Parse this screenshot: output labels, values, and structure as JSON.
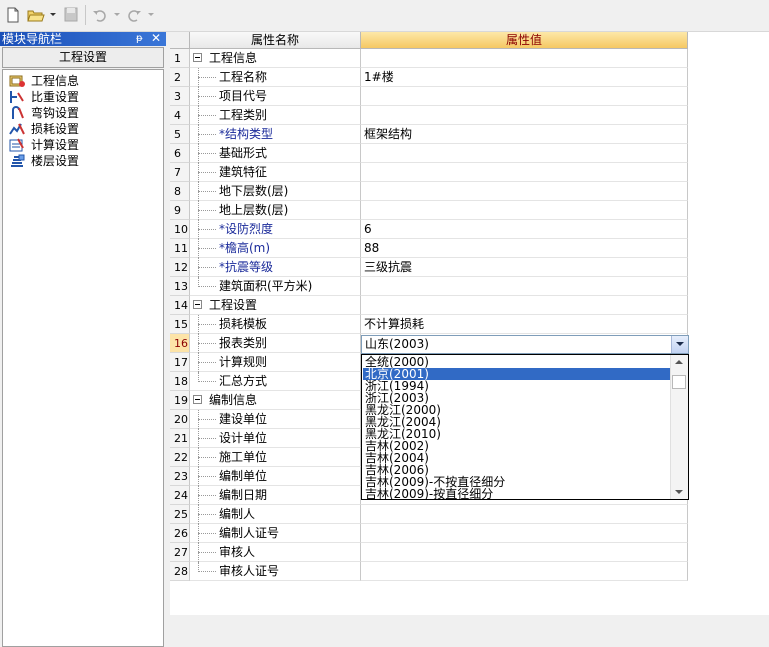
{
  "toolbar": {
    "icons": [
      "new-file-icon",
      "open-folder-icon",
      "save-icon",
      "undo-icon",
      "redo-icon",
      "more-icon"
    ]
  },
  "nav": {
    "title": "模块导航栏",
    "pin": "ᵽ",
    "close": "✕",
    "header": "工程设置",
    "items": [
      {
        "label": "工程信息",
        "icon": "project-info-icon"
      },
      {
        "label": "比重设置",
        "icon": "density-icon"
      },
      {
        "label": "弯钩设置",
        "icon": "hook-icon"
      },
      {
        "label": "损耗设置",
        "icon": "loss-icon"
      },
      {
        "label": "计算设置",
        "icon": "calc-icon"
      },
      {
        "label": "楼层设置",
        "icon": "floor-icon"
      }
    ]
  },
  "grid": {
    "col_name": "属性名称",
    "col_value": "属性值",
    "rows": [
      {
        "num": "1",
        "name": "工程信息",
        "value": "",
        "type": "group"
      },
      {
        "num": "2",
        "name": "工程名称",
        "value": "1#楼",
        "type": "child"
      },
      {
        "num": "3",
        "name": "项目代号",
        "value": "",
        "type": "child"
      },
      {
        "num": "4",
        "name": "工程类别",
        "value": "",
        "type": "child"
      },
      {
        "num": "5",
        "name": "*结构类型",
        "value": "框架结构",
        "type": "child",
        "req": true
      },
      {
        "num": "6",
        "name": "基础形式",
        "value": "",
        "type": "child"
      },
      {
        "num": "7",
        "name": "建筑特征",
        "value": "",
        "type": "child"
      },
      {
        "num": "8",
        "name": "地下层数(层)",
        "value": "",
        "type": "child"
      },
      {
        "num": "9",
        "name": "地上层数(层)",
        "value": "",
        "type": "child"
      },
      {
        "num": "10",
        "name": "*设防烈度",
        "value": "6",
        "type": "child",
        "req": true
      },
      {
        "num": "11",
        "name": "*檐高(m)",
        "value": "88",
        "type": "child",
        "req": true
      },
      {
        "num": "12",
        "name": "*抗震等级",
        "value": "三级抗震",
        "type": "child",
        "req": true
      },
      {
        "num": "13",
        "name": "建筑面积(平方米)",
        "value": "",
        "type": "child",
        "last": true
      },
      {
        "num": "14",
        "name": "工程设置",
        "value": "",
        "type": "group"
      },
      {
        "num": "15",
        "name": "损耗模板",
        "value": "不计算损耗",
        "type": "child"
      },
      {
        "num": "16",
        "name": "报表类别",
        "value": "",
        "type": "child",
        "sel": true
      },
      {
        "num": "17",
        "name": "计算规则",
        "value": "",
        "type": "child"
      },
      {
        "num": "18",
        "name": "汇总方式",
        "value": "",
        "type": "child",
        "last": true
      },
      {
        "num": "19",
        "name": "编制信息",
        "value": "",
        "type": "group"
      },
      {
        "num": "20",
        "name": "建设单位",
        "value": "",
        "type": "child"
      },
      {
        "num": "21",
        "name": "设计单位",
        "value": "",
        "type": "child"
      },
      {
        "num": "22",
        "name": "施工单位",
        "value": "",
        "type": "child"
      },
      {
        "num": "23",
        "name": "编制单位",
        "value": "",
        "type": "child"
      },
      {
        "num": "24",
        "name": "编制日期",
        "value": "",
        "type": "child"
      },
      {
        "num": "25",
        "name": "编制人",
        "value": "",
        "type": "child"
      },
      {
        "num": "26",
        "name": "编制人证号",
        "value": "",
        "type": "child"
      },
      {
        "num": "27",
        "name": "审核人",
        "value": "",
        "type": "child"
      },
      {
        "num": "28",
        "name": "审核人证号",
        "value": "",
        "type": "child",
        "last": true
      }
    ]
  },
  "combo": {
    "value": "山东(2003)"
  },
  "dropdown": {
    "selected_index": 1,
    "options": [
      "全统(2000)",
      "北京(2001)",
      "浙江(1994)",
      "浙江(2003)",
      "黑龙江(2000)",
      "黑龙江(2004)",
      "黑龙江(2010)",
      "吉林(2002)",
      "吉林(2004)",
      "吉林(2006)",
      "吉林(2009)-不按直径细分",
      "吉林(2009)-按直径细分"
    ]
  },
  "colors": {
    "title_bar": "#3a76d8",
    "value_header": "#f5c864",
    "highlight": "#316ac5",
    "required_label": "#1a2a9a"
  }
}
